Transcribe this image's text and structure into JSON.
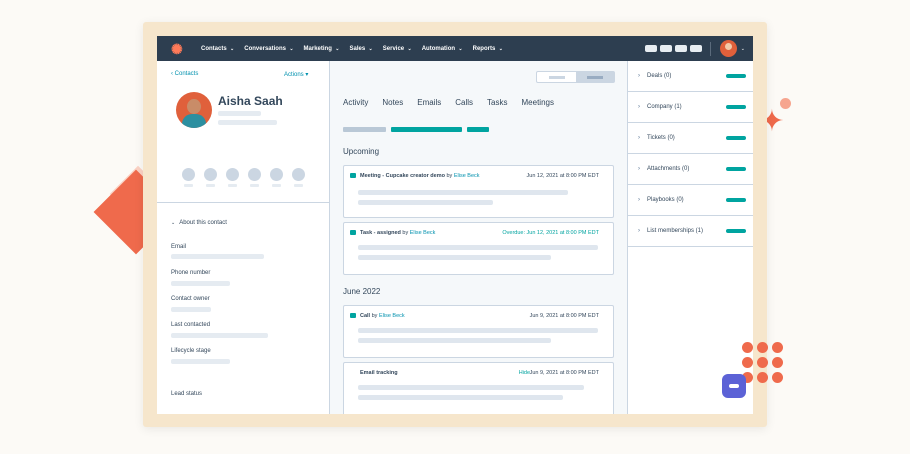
{
  "nav": {
    "items": [
      {
        "label": "Contacts"
      },
      {
        "label": "Conversations"
      },
      {
        "label": "Marketing"
      },
      {
        "label": "Sales"
      },
      {
        "label": "Service"
      },
      {
        "label": "Automation"
      },
      {
        "label": "Reports"
      }
    ]
  },
  "sidebar": {
    "back_label": "Contacts",
    "actions_label": "Actions",
    "contact_name": "Aisha Saah",
    "about_label": "About this contact",
    "fields": [
      "Email",
      "Phone number",
      "Contact owner",
      "Last contacted",
      "Lifecycle stage",
      "Lead status"
    ]
  },
  "main": {
    "tabs": [
      "Activity",
      "Notes",
      "Emails",
      "Calls",
      "Tasks",
      "Meetings"
    ],
    "upcoming_heading": "Upcoming",
    "month_heading": "June 2022",
    "cards": [
      {
        "type": "Meeting",
        "title": "Meeting - Cupcake creator demo",
        "by_prefix": "by",
        "by": "Elise Beck",
        "date": "Jun 12, 2021 at 8:00 PM EDT"
      },
      {
        "type": "Task",
        "title": "Task - assigned",
        "by_prefix": "by",
        "by": "Elise Beck",
        "date": "Overdue: Jun 12, 2021 at 8:00 PM EDT"
      },
      {
        "type": "Call",
        "title": "Call",
        "by_prefix": "by",
        "by": "Elise Beck",
        "date": "Jun 9, 2021 at 8:00 PM EDT"
      },
      {
        "type": "Email",
        "title": "Email tracking",
        "hide": "Hide",
        "date": "Jun 9, 2021 at 8:00 PM EDT"
      }
    ]
  },
  "right_panel": {
    "items": [
      {
        "label": "Deals (0)"
      },
      {
        "label": "Company (1)"
      },
      {
        "label": "Tickets (0)"
      },
      {
        "label": "Attachments (0)"
      },
      {
        "label": "Playbooks (0)"
      },
      {
        "label": "List memberships (1)"
      }
    ]
  },
  "colors": {
    "nav_bg": "#2d3e50",
    "accent_teal": "#00a4a0",
    "link_blue": "#0091ae",
    "brand_orange": "#ff7a59"
  }
}
